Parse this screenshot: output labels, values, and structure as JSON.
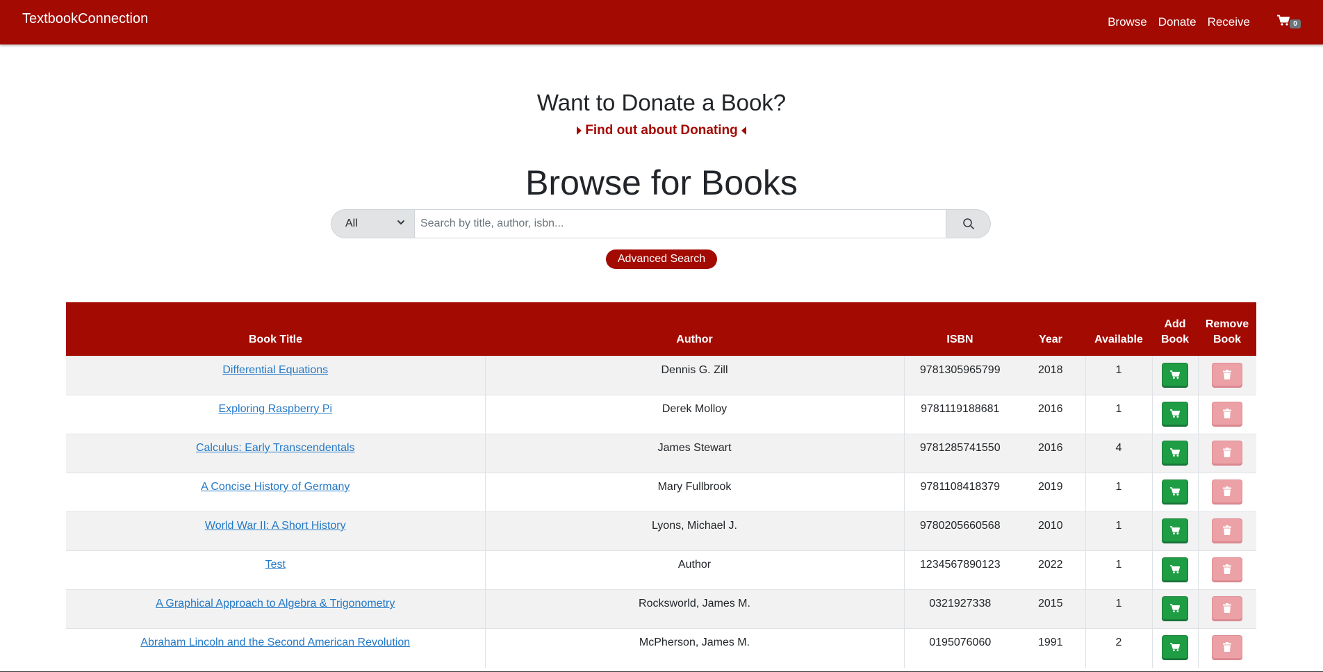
{
  "nav": {
    "brand": "TextbookConnection",
    "links": [
      "Browse",
      "Donate",
      "Receive"
    ],
    "cart_count": "0"
  },
  "donate": {
    "heading": "Want to Donate a Book?",
    "link": "Find out about Donating"
  },
  "browse": {
    "heading": "Browse for Books",
    "filter_selected": "All",
    "search_placeholder": "Search by title, author, isbn...",
    "advanced_button": "Advanced Search"
  },
  "table": {
    "headers": {
      "title": "Book Title",
      "author": "Author",
      "isbn": "ISBN",
      "year": "Year",
      "available": "Available",
      "add_line1": "Add",
      "add_line2": "Book",
      "remove_line1": "Remove",
      "remove_line2": "Book"
    },
    "rows": [
      {
        "title": "Differential Equations",
        "author": "Dennis G. Zill",
        "isbn": "9781305965799",
        "year": "2018",
        "available": "1"
      },
      {
        "title": "Exploring Raspberry Pi",
        "author": "Derek Molloy",
        "isbn": "9781119188681",
        "year": "2016",
        "available": "1"
      },
      {
        "title": "Calculus: Early Transcendentals",
        "author": "James Stewart",
        "isbn": "9781285741550",
        "year": "2016",
        "available": "4"
      },
      {
        "title": "A Concise History of Germany",
        "author": "Mary Fullbrook",
        "isbn": "9781108418379",
        "year": "2019",
        "available": "1"
      },
      {
        "title": "World War II: A Short History",
        "author": "Lyons, Michael J.",
        "isbn": "9780205660568",
        "year": "2010",
        "available": "1"
      },
      {
        "title": "Test",
        "author": "Author",
        "isbn": "1234567890123",
        "year": "2022",
        "available": "1"
      },
      {
        "title": "A Graphical Approach to Algebra & Trigonometry",
        "author": "Rocksworld, James M.",
        "isbn": "0321927338",
        "year": "2015",
        "available": "1"
      },
      {
        "title": "Abraham Lincoln and the Second American Revolution",
        "author": "McPherson, James M.",
        "isbn": "0195076060",
        "year": "1991",
        "available": "2"
      }
    ]
  },
  "colors": {
    "brand": "#a30a02",
    "add_button": "#1f9d44",
    "remove_button": "#eba1a6",
    "link": "#2479c7"
  },
  "icons": {
    "cart": "cart-icon",
    "dropdown": "chevron-down-icon",
    "search": "search-icon",
    "add": "cart-icon",
    "remove": "trash-icon"
  }
}
